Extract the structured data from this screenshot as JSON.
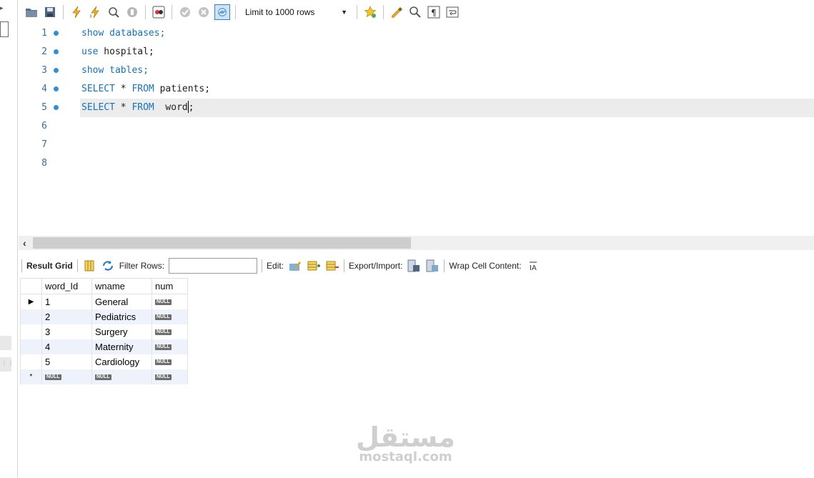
{
  "toolbar": {
    "limit_label": "Limit to 1000 rows",
    "icons": [
      "open-folder-icon",
      "save-icon",
      "execute-icon",
      "execute-current-icon",
      "explain-icon",
      "stop-icon",
      "toggle-output-icon",
      "commit-icon",
      "rollback-icon",
      "autocommit-icon",
      "limit-select",
      "bookmark-icon",
      "beautify-icon",
      "find-icon",
      "invisible-chars-icon",
      "wrap-icon"
    ]
  },
  "editor": {
    "lines": [
      {
        "n": "1",
        "dot": true
      },
      {
        "n": "2",
        "dot": true
      },
      {
        "n": "3",
        "dot": true
      },
      {
        "n": "4",
        "dot": true
      },
      {
        "n": "5",
        "dot": true
      },
      {
        "n": "6",
        "dot": false
      },
      {
        "n": "7",
        "dot": false
      },
      {
        "n": "8",
        "dot": false
      }
    ],
    "code": {
      "l1_kw": "show databases;",
      "l2_kw": "use",
      "l2_rest": " hospital;",
      "l3_kw": "show tables;",
      "l4_kw1": "SELECT",
      "l4_mid": " * ",
      "l4_kw2": "FROM",
      "l4_rest": " patients;",
      "l5_kw1": "SELECT",
      "l5_mid": " * ",
      "l5_kw2": "FROM",
      "l5_rest_a": "  word",
      "l5_rest_b": ";"
    }
  },
  "result_toolbar": {
    "result_grid": "Result Grid",
    "filter_rows": "Filter Rows:",
    "edit": "Edit:",
    "export_import": "Export/Import:",
    "wrap_cell": "Wrap Cell Content:"
  },
  "grid": {
    "columns": [
      "word_Id",
      "wname",
      "num"
    ],
    "rows": [
      {
        "id": "1",
        "wname": "General",
        "num": "NULL"
      },
      {
        "id": "2",
        "wname": "Pediatrics",
        "num": "NULL"
      },
      {
        "id": "3",
        "wname": "Surgery",
        "num": "NULL"
      },
      {
        "id": "4",
        "wname": "Maternity",
        "num": "NULL"
      },
      {
        "id": "5",
        "wname": "Cardiology",
        "num": "NULL"
      }
    ],
    "new_row": {
      "marker": "*",
      "id": "NULL",
      "wname": "NULL",
      "num": "NULL"
    }
  },
  "watermark": {
    "arabic": "مستقل",
    "latin": "mostaql.com"
  }
}
